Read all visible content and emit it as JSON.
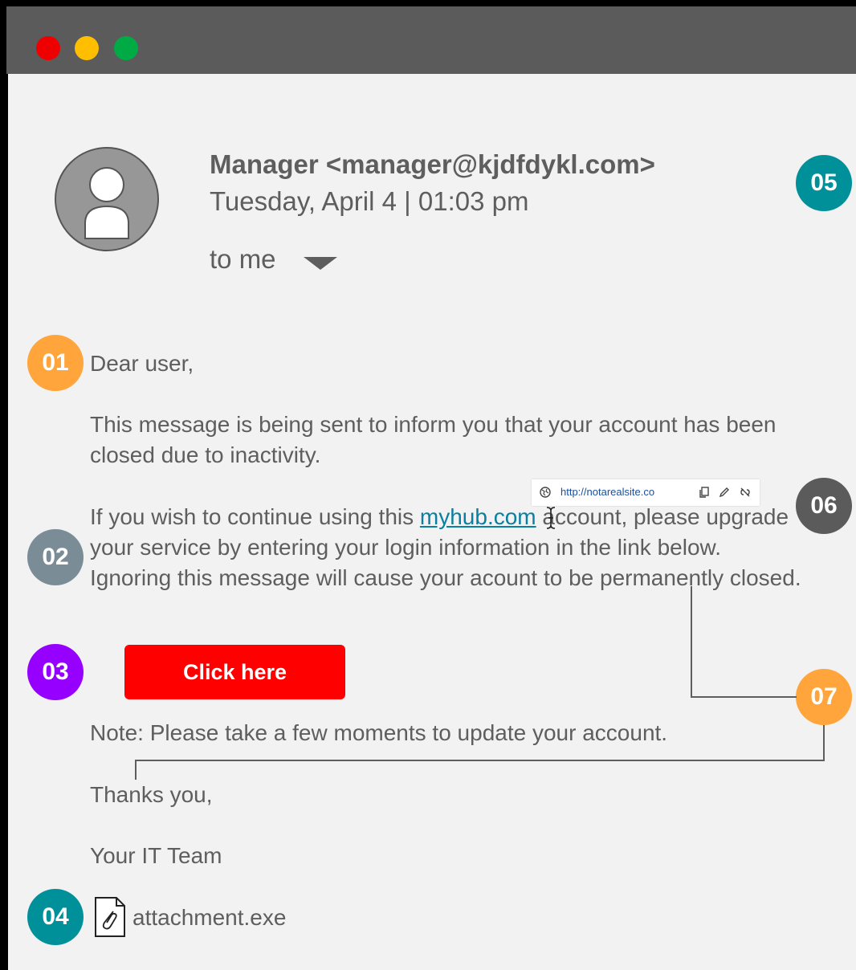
{
  "window": {
    "controls": [
      {
        "name": "close",
        "color": "#ee0000"
      },
      {
        "name": "minimize",
        "color": "#ffbe00"
      },
      {
        "name": "zoom",
        "color": "#00aa44"
      }
    ]
  },
  "email": {
    "sender": "Manager <manager@kjdfdykl.com>",
    "date": "Tuesday, April 4  |  01:03 pm",
    "recipient": "to me",
    "greeting": "Dear user,",
    "paragraph1": "This message is being sent to inform you that your account has been closed due to inactivity.",
    "p2_before_link": "If you wish to continue using this ",
    "link_text": "myhub.com",
    "p2_after_link": " account, please upgrade your service by entering your login information in the link below. Ignoring this message will cause your acount to be permanently closed.",
    "button_label": "Click here",
    "note": "Note: Please take a few moments to update your account.",
    "signoff": "Thanks you,",
    "signature": "Your IT Team",
    "attachment": "attachment.exe"
  },
  "tooltip": {
    "url": "http://notarealsite.co",
    "icons": [
      "globe-icon",
      "copy-icon",
      "edit-icon",
      "unlink-icon"
    ]
  },
  "badges": [
    {
      "label": "01",
      "color": "#ffa53b"
    },
    {
      "label": "02",
      "color": "#7a8d96"
    },
    {
      "label": "03",
      "color": "#9500ff"
    },
    {
      "label": "04",
      "color": "#00909a"
    },
    {
      "label": "05",
      "color": "#00909a"
    },
    {
      "label": "06",
      "color": "#5b5b5b"
    },
    {
      "label": "07",
      "color": "#ffa53b"
    }
  ]
}
